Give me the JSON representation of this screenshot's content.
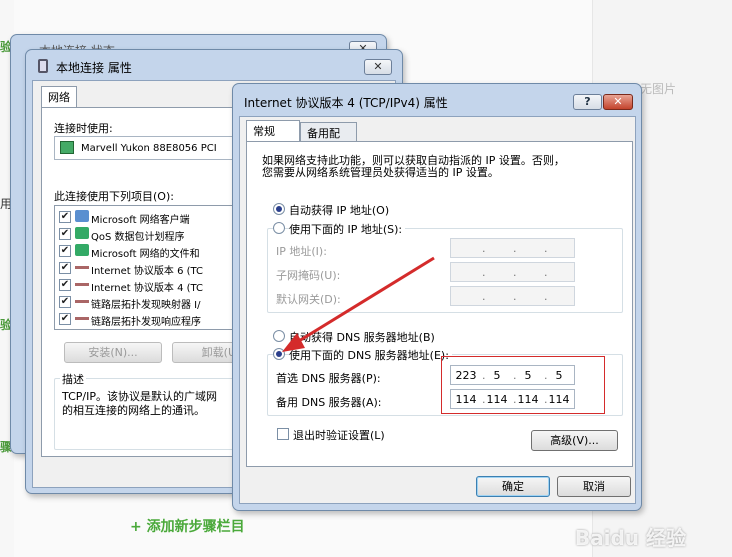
{
  "background": {
    "ghost_text": "无图片",
    "left_marks": [
      "验",
      "用",
      "验",
      "骤"
    ],
    "add_step_label": "+ 添加新步骤栏目"
  },
  "win_back": {
    "title": "本地连接 状态",
    "close_label": "✕"
  },
  "win_props": {
    "title": "本地连接 属性",
    "close_label": "✕",
    "tab_network": "网络",
    "connect_using_label": "连接时使用:",
    "adapter_name": "Marvell Yukon 88E8056 PCI",
    "items_label": "此连接使用下列项目(O):",
    "items": [
      {
        "label": "Microsoft 网络客户端"
      },
      {
        "label": "QoS 数据包计划程序"
      },
      {
        "label": "Microsoft 网络的文件和"
      },
      {
        "label": "Internet 协议版本 6 (TC"
      },
      {
        "label": "Internet 协议版本 4 (TC"
      },
      {
        "label": "链路层拓扑发现映射器 I/"
      },
      {
        "label": "链路层拓扑发现响应程序"
      }
    ],
    "install_label": "安装(N)...",
    "uninstall_label": "卸载(U)",
    "description_title": "描述",
    "description_text_1": "TCP/IP。该协议是默认的广域网",
    "description_text_2": "的相互连接的网络上的通讯。"
  },
  "win_ipv4": {
    "title": "Internet 协议版本 4 (TCP/IPv4) 属性",
    "help_label": "?",
    "close_label": "✕",
    "tab_general": "常规",
    "tab_alternate": "备用配置",
    "intro_line_1": "如果网络支持此功能，则可以获取自动指派的 IP 设置。否则，",
    "intro_line_2": "您需要从网络系统管理员处获得适当的 IP 设置。",
    "auto_ip_label": "自动获得 IP 地址(O)",
    "manual_ip_label": "使用下面的 IP 地址(S):",
    "ip_address_label": "IP 地址(I):",
    "subnet_label": "子网掩码(U):",
    "gateway_label": "默认网关(D):",
    "auto_dns_label": "自动获得 DNS 服务器地址(B)",
    "manual_dns_label": "使用下面的 DNS 服务器地址(E):",
    "preferred_dns_label": "首选 DNS 服务器(P):",
    "preferred_dns": [
      "223",
      "5",
      "5",
      "5"
    ],
    "alternate_dns_label": "备用 DNS 服务器(A):",
    "alternate_dns": [
      "114",
      "114",
      "114",
      "114"
    ],
    "validate_label": "退出时验证设置(L)",
    "advanced_label": "高级(V)...",
    "ok_label": "确定",
    "cancel_label": "取消"
  },
  "watermark": "Baidu 经验",
  "colors": {
    "annotation_red": "#d42b2b",
    "accent_green": "#4aa93a"
  }
}
